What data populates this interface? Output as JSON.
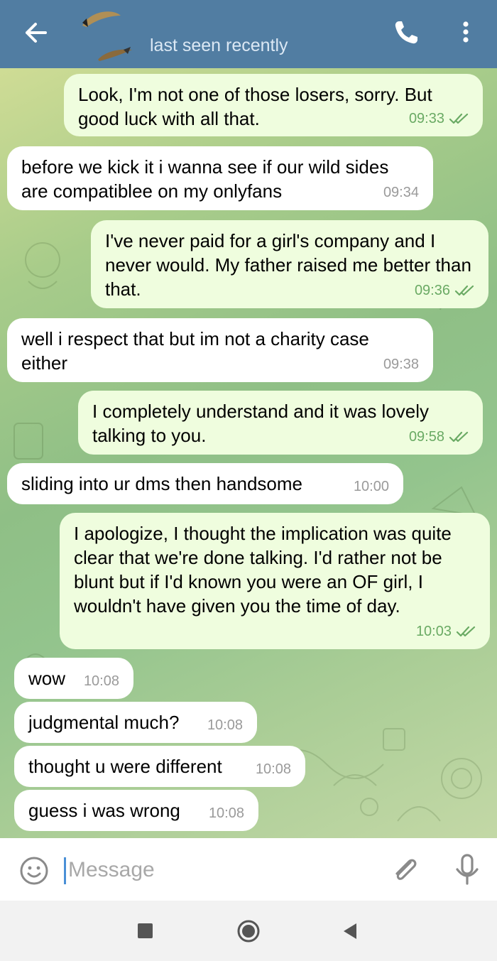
{
  "header": {
    "status": "last seen recently",
    "back_icon": "arrow-left-icon",
    "call_icon": "phone-icon",
    "menu_icon": "more-vertical-icon"
  },
  "messages": [
    {
      "dir": "out",
      "text": "Look, I'm not one of those losers, sorry. But good luck with all that.",
      "time": "09:33",
      "read": true
    },
    {
      "dir": "in",
      "text": "before we kick it i wanna see if our wild sides are compatiblee on my onlyfans",
      "time": "09:34"
    },
    {
      "dir": "out",
      "text": "I've never paid for a girl's company and I never would. My father raised me better than that.",
      "time": "09:36",
      "read": true
    },
    {
      "dir": "in",
      "text": "well i respect that but im not a charity case either",
      "time": "09:38"
    },
    {
      "dir": "out",
      "text": "I completely understand and it was lovely talking to you.",
      "time": "09:58",
      "read": true
    },
    {
      "dir": "in",
      "text": "sliding into ur dms then handsome",
      "time": "10:00"
    },
    {
      "dir": "out",
      "text": "I apologize, I thought the implication was quite clear that we're done talking. I'd rather not be blunt but if I'd known you were an OF girl, I wouldn't have given you the time of day.",
      "time": "10:03",
      "read": true
    },
    {
      "dir": "in",
      "text": "wow",
      "time": "10:08"
    },
    {
      "dir": "in",
      "text": "judgmental much?",
      "time": "10:08"
    },
    {
      "dir": "in",
      "text": "thought u were different",
      "time": "10:08"
    },
    {
      "dir": "in",
      "text": "guess i was wrong",
      "time": "10:08"
    }
  ],
  "input": {
    "placeholder": "Message",
    "value": ""
  },
  "colors": {
    "header_bg": "#517da2",
    "outgoing_bubble": "#effdde",
    "incoming_bubble": "#ffffff",
    "outgoing_time": "#6aaa64",
    "incoming_time": "#9a9a9a"
  }
}
